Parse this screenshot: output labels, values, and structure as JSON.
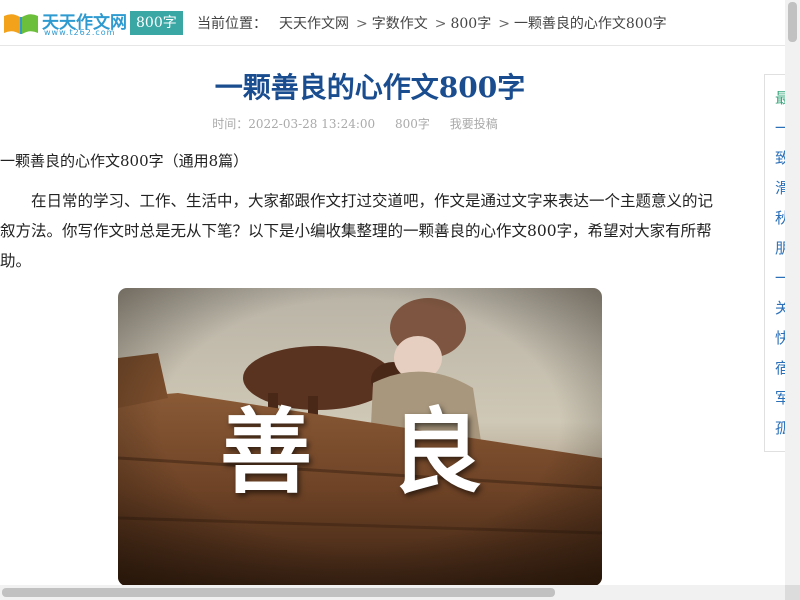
{
  "header": {
    "logo_text": "天天作文网",
    "logo_sub": "www.t262.com",
    "category_badge": "800字",
    "breadcrumb": {
      "label": "当前位置：",
      "items": [
        "天天作文网",
        "字数作文",
        "800字",
        "一颗善良的心作文800字"
      ],
      "separator": ">"
    }
  },
  "article": {
    "title": "一颗善良的心作文800字",
    "meta": {
      "time": "时间：2022-03-28 13:24:00",
      "category": "800字",
      "submit_link": "我要投稿"
    },
    "subtitle": "一颗善良的心作文800字（通用8篇）",
    "paragraph": "在日常的学习、工作、生活中，大家都跟作文打过交道吧，作文是通过文字来表达一个主题意义的记叙方法。你写作文时总是无从下笔？以下是小编收集整理的一颗善良的心作文800字，希望对大家有所帮助。",
    "image_text": [
      "善",
      "良"
    ]
  },
  "sidebar": {
    "items": [
      "最",
      "一",
      "致",
      "滑",
      "秋",
      "朋",
      "一",
      "关",
      "快",
      "宿",
      "军",
      "孤"
    ]
  },
  "colors": {
    "title": "#1a4d8f",
    "badge": "#3aa7a5",
    "logo": "#2e9ad0",
    "side_link": "#2a6fb8"
  }
}
